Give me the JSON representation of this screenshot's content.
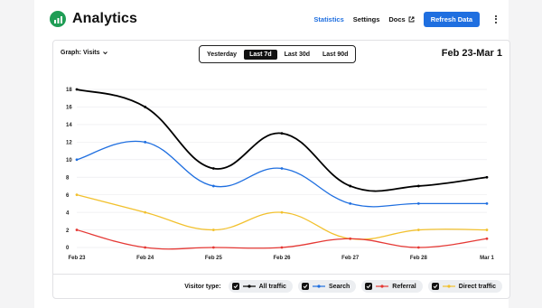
{
  "header": {
    "title": "Analytics",
    "nav": [
      {
        "label": "Statistics",
        "active": true
      },
      {
        "label": "Settings",
        "active": false
      },
      {
        "label": "Docs",
        "active": false,
        "icon": "external-link-icon"
      }
    ],
    "refresh_label": "Refresh Data",
    "menu_icon": "kebab-menu-icon",
    "logo_icon": "chart-icon",
    "accent": "#1f6fe0",
    "logo_color": "#1f9d55"
  },
  "controls": {
    "graph_label": "Graph:",
    "graph_value": "Visits",
    "ranges": [
      {
        "label": "Yesterday",
        "active": false
      },
      {
        "label": "Last 7d",
        "active": true
      },
      {
        "label": "Last 30d",
        "active": false
      },
      {
        "label": "Last 90d",
        "active": false
      }
    ],
    "date_range": "Feb 23-Mar 1"
  },
  "chart_data": {
    "type": "line",
    "x": [
      "Feb 23",
      "Feb 24",
      "Feb 25",
      "Feb 26",
      "Feb 27",
      "Feb 28",
      "Mar 1"
    ],
    "series": [
      {
        "name": "All traffic",
        "color": "#000000",
        "values": [
          18,
          16,
          9,
          13,
          7,
          7,
          8
        ]
      },
      {
        "name": "Search",
        "color": "#1f6fe0",
        "values": [
          10,
          12,
          7,
          9,
          5,
          5,
          5
        ]
      },
      {
        "name": "Referral",
        "color": "#e53935",
        "values": [
          2,
          0,
          0,
          0,
          1,
          0,
          1
        ]
      },
      {
        "name": "Direct traffic",
        "color": "#f2c12e",
        "values": [
          6,
          4,
          2,
          4,
          1,
          2,
          2
        ]
      }
    ],
    "ylim": [
      0,
      18
    ],
    "yticks": [
      0,
      2,
      4,
      6,
      8,
      10,
      12,
      14,
      16,
      18
    ],
    "grid": true,
    "smooth": true
  },
  "legend": {
    "label": "Visitor type:",
    "items": [
      "All traffic",
      "Search",
      "Referral",
      "Direct traffic"
    ]
  }
}
